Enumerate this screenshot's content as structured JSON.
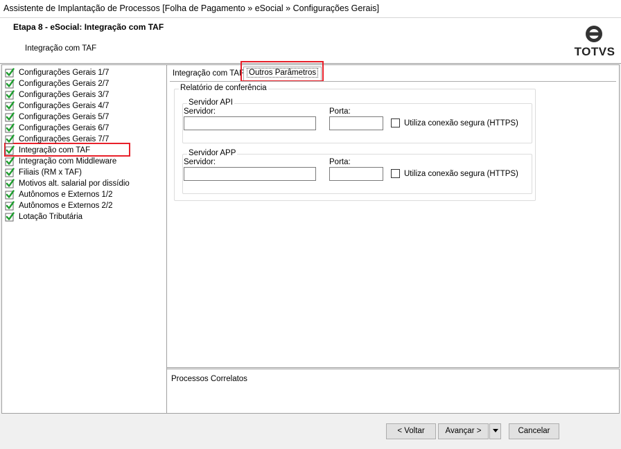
{
  "window": {
    "title": "Assistente de Implantação de Processos [Folha de Pagamento » eSocial » Configurações Gerais]"
  },
  "header": {
    "step_title": "Etapa 8 - eSocial: Integração com TAF",
    "step_subtitle": "Integração com TAF",
    "logo_text": "TOTVS"
  },
  "steps": [
    {
      "label": "Configurações Gerais 1/7",
      "icon": "check-icon"
    },
    {
      "label": "Configurações Gerais 2/7",
      "icon": "check-icon"
    },
    {
      "label": "Configurações Gerais 3/7",
      "icon": "check-icon"
    },
    {
      "label": "Configurações Gerais 4/7",
      "icon": "check-icon"
    },
    {
      "label": "Configurações Gerais 5/7",
      "icon": "check-icon"
    },
    {
      "label": "Configurações Gerais 6/7",
      "icon": "check-icon"
    },
    {
      "label": "Configurações Gerais 7/7",
      "icon": "check-icon"
    },
    {
      "label": "Integração com TAF",
      "icon": "check-icon"
    },
    {
      "label": "Integração com Middleware",
      "icon": "check-icon"
    },
    {
      "label": "Filiais (RM x TAF)",
      "icon": "check-icon"
    },
    {
      "label": "Motivos alt. salarial por dissídio",
      "icon": "check-icon"
    },
    {
      "label": "Autônomos e Externos 1/2",
      "icon": "check-icon"
    },
    {
      "label": "Autônomos e Externos 2/2",
      "icon": "check-icon"
    },
    {
      "label": "Lotação Tributária",
      "icon": "check-icon"
    }
  ],
  "selected_step": "Integração com TAF",
  "tabs": [
    {
      "label": "Integração com TAF",
      "active": false
    },
    {
      "label": "Outros Parâmetros",
      "active": true
    }
  ],
  "relatorio": {
    "legend": "Relatório de conferência",
    "api": {
      "legend": "Servidor API",
      "servidor_label": "Servidor:",
      "servidor_value": "",
      "porta_label": "Porta:",
      "porta_value": "",
      "https_label": "Utiliza conexão segura (HTTPS)",
      "https_checked": false
    },
    "app": {
      "legend": "Servidor APP",
      "servidor_label": "Servidor:",
      "servidor_value": "",
      "porta_label": "Porta:",
      "porta_value": "",
      "https_label": "Utiliza conexão segura (HTTPS)",
      "https_checked": false
    }
  },
  "correlatos": {
    "title": "Processos Correlatos"
  },
  "buttons": {
    "voltar": "< Voltar",
    "avancar": "Avançar >",
    "cancelar": "Cancelar"
  },
  "colors": {
    "highlight": "#e8202a",
    "check_green": "#1e9e2f"
  }
}
